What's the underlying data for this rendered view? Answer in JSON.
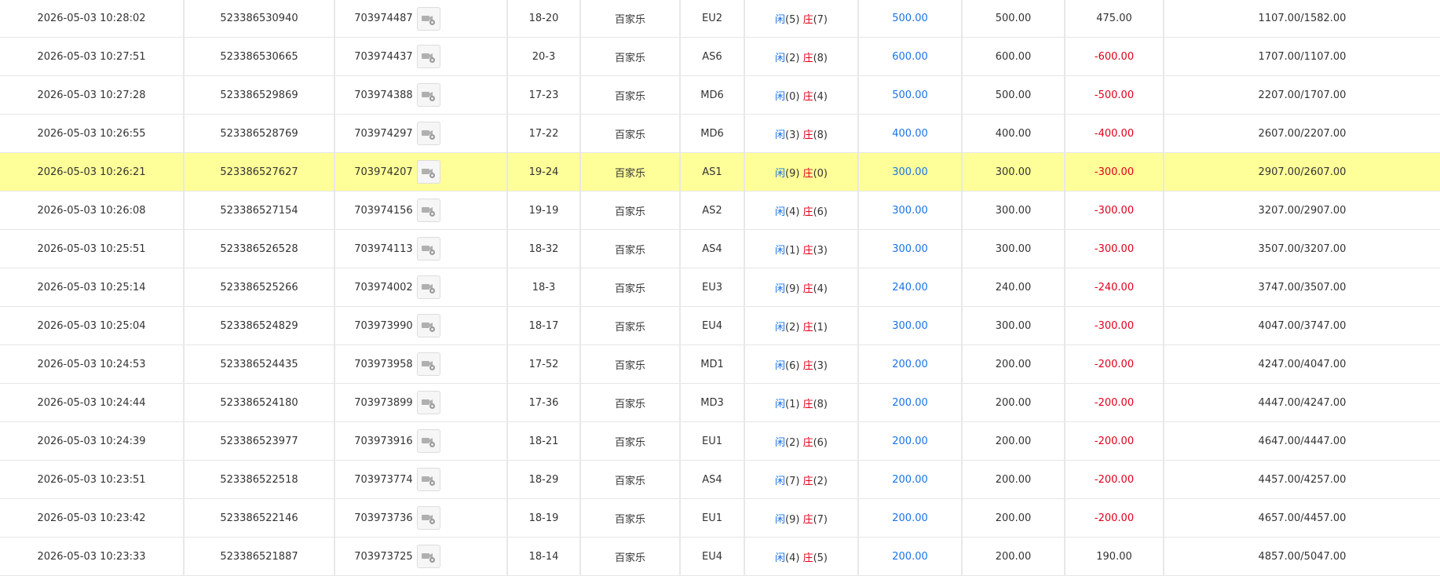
{
  "labels": {
    "player": "闲",
    "banker": "庄"
  },
  "colors": {
    "player": "#1a73e8",
    "banker": "#e0001b",
    "highlight_row": "#ffff99"
  },
  "icons": {
    "detail": "video-camera-gear-icon"
  },
  "rows": [
    {
      "time": "2026-05-03 10:28:02",
      "order_no": "523386530940",
      "game_no": "703974487",
      "shoe": "18-20",
      "game_type": "百家乐",
      "table": "EU2",
      "player_score": "(5)",
      "banker_score": "(7)",
      "bet": "500.00",
      "valid_bet": "500.00",
      "win_loss": "475.00",
      "win_color": "dark",
      "balance": "1107.00/1582.00",
      "highlight": false
    },
    {
      "time": "2026-05-03 10:27:51",
      "order_no": "523386530665",
      "game_no": "703974437",
      "shoe": "20-3",
      "game_type": "百家乐",
      "table": "AS6",
      "player_score": "(2)",
      "banker_score": "(8)",
      "bet": "600.00",
      "valid_bet": "600.00",
      "win_loss": "-600.00",
      "win_color": "red",
      "balance": "1707.00/1107.00",
      "highlight": false
    },
    {
      "time": "2026-05-03 10:27:28",
      "order_no": "523386529869",
      "game_no": "703974388",
      "shoe": "17-23",
      "game_type": "百家乐",
      "table": "MD6",
      "player_score": "(0)",
      "banker_score": "(4)",
      "bet": "500.00",
      "valid_bet": "500.00",
      "win_loss": "-500.00",
      "win_color": "red",
      "balance": "2207.00/1707.00",
      "highlight": false
    },
    {
      "time": "2026-05-03 10:26:55",
      "order_no": "523386528769",
      "game_no": "703974297",
      "shoe": "17-22",
      "game_type": "百家乐",
      "table": "MD6",
      "player_score": "(3)",
      "banker_score": "(8)",
      "bet": "400.00",
      "valid_bet": "400.00",
      "win_loss": "-400.00",
      "win_color": "red",
      "balance": "2607.00/2207.00",
      "highlight": false
    },
    {
      "time": "2026-05-03 10:26:21",
      "order_no": "523386527627",
      "game_no": "703974207",
      "shoe": "19-24",
      "game_type": "百家乐",
      "table": "AS1",
      "player_score": "(9)",
      "banker_score": "(0)",
      "bet": "300.00",
      "valid_bet": "300.00",
      "win_loss": "-300.00",
      "win_color": "red",
      "balance": "2907.00/2607.00",
      "highlight": true
    },
    {
      "time": "2026-05-03 10:26:08",
      "order_no": "523386527154",
      "game_no": "703974156",
      "shoe": "19-19",
      "game_type": "百家乐",
      "table": "AS2",
      "player_score": "(4)",
      "banker_score": "(6)",
      "bet": "300.00",
      "valid_bet": "300.00",
      "win_loss": "-300.00",
      "win_color": "red",
      "balance": "3207.00/2907.00",
      "highlight": false
    },
    {
      "time": "2026-05-03 10:25:51",
      "order_no": "523386526528",
      "game_no": "703974113",
      "shoe": "18-32",
      "game_type": "百家乐",
      "table": "AS4",
      "player_score": "(1)",
      "banker_score": "(3)",
      "bet": "300.00",
      "valid_bet": "300.00",
      "win_loss": "-300.00",
      "win_color": "red",
      "balance": "3507.00/3207.00",
      "highlight": false
    },
    {
      "time": "2026-05-03 10:25:14",
      "order_no": "523386525266",
      "game_no": "703974002",
      "shoe": "18-3",
      "game_type": "百家乐",
      "table": "EU3",
      "player_score": "(9)",
      "banker_score": "(4)",
      "bet": "240.00",
      "valid_bet": "240.00",
      "win_loss": "-240.00",
      "win_color": "red",
      "balance": "3747.00/3507.00",
      "highlight": false
    },
    {
      "time": "2026-05-03 10:25:04",
      "order_no": "523386524829",
      "game_no": "703973990",
      "shoe": "18-17",
      "game_type": "百家乐",
      "table": "EU4",
      "player_score": "(2)",
      "banker_score": "(1)",
      "bet": "300.00",
      "valid_bet": "300.00",
      "win_loss": "-300.00",
      "win_color": "red",
      "balance": "4047.00/3747.00",
      "highlight": false
    },
    {
      "time": "2026-05-03 10:24:53",
      "order_no": "523386524435",
      "game_no": "703973958",
      "shoe": "17-52",
      "game_type": "百家乐",
      "table": "MD1",
      "player_score": "(6)",
      "banker_score": "(3)",
      "bet": "200.00",
      "valid_bet": "200.00",
      "win_loss": "-200.00",
      "win_color": "red",
      "balance": "4247.00/4047.00",
      "highlight": false
    },
    {
      "time": "2026-05-03 10:24:44",
      "order_no": "523386524180",
      "game_no": "703973899",
      "shoe": "17-36",
      "game_type": "百家乐",
      "table": "MD3",
      "player_score": "(1)",
      "banker_score": "(8)",
      "bet": "200.00",
      "valid_bet": "200.00",
      "win_loss": "-200.00",
      "win_color": "red",
      "balance": "4447.00/4247.00",
      "highlight": false
    },
    {
      "time": "2026-05-03 10:24:39",
      "order_no": "523386523977",
      "game_no": "703973916",
      "shoe": "18-21",
      "game_type": "百家乐",
      "table": "EU1",
      "player_score": "(2)",
      "banker_score": "(6)",
      "bet": "200.00",
      "valid_bet": "200.00",
      "win_loss": "-200.00",
      "win_color": "red",
      "balance": "4647.00/4447.00",
      "highlight": false
    },
    {
      "time": "2026-05-03 10:23:51",
      "order_no": "523386522518",
      "game_no": "703973774",
      "shoe": "18-29",
      "game_type": "百家乐",
      "table": "AS4",
      "player_score": "(7)",
      "banker_score": "(2)",
      "bet": "200.00",
      "valid_bet": "200.00",
      "win_loss": "-200.00",
      "win_color": "red",
      "balance": "4457.00/4257.00",
      "highlight": false
    },
    {
      "time": "2026-05-03 10:23:42",
      "order_no": "523386522146",
      "game_no": "703973736",
      "shoe": "18-19",
      "game_type": "百家乐",
      "table": "EU1",
      "player_score": "(9)",
      "banker_score": "(7)",
      "bet": "200.00",
      "valid_bet": "200.00",
      "win_loss": "-200.00",
      "win_color": "red",
      "balance": "4657.00/4457.00",
      "highlight": false
    },
    {
      "time": "2026-05-03 10:23:33",
      "order_no": "523386521887",
      "game_no": "703973725",
      "shoe": "18-14",
      "game_type": "百家乐",
      "table": "EU4",
      "player_score": "(4)",
      "banker_score": "(5)",
      "bet": "200.00",
      "valid_bet": "200.00",
      "win_loss": "190.00",
      "win_color": "dark",
      "balance": "4857.00/5047.00",
      "highlight": false
    }
  ]
}
